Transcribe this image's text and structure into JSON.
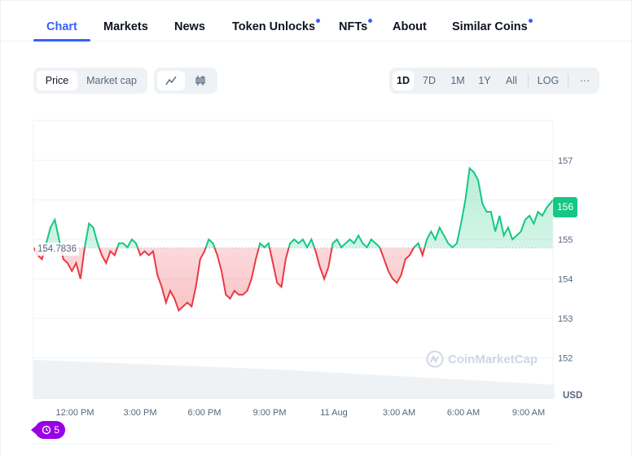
{
  "tabs": [
    {
      "label": "Chart",
      "active": true,
      "dot": false
    },
    {
      "label": "Markets",
      "active": false,
      "dot": false
    },
    {
      "label": "News",
      "active": false,
      "dot": false
    },
    {
      "label": "Token Unlocks",
      "active": false,
      "dot": true
    },
    {
      "label": "NFTs",
      "active": false,
      "dot": true
    },
    {
      "label": "About",
      "active": false,
      "dot": false
    },
    {
      "label": "Similar Coins",
      "active": false,
      "dot": true
    }
  ],
  "toolbar": {
    "metric": {
      "price": "Price",
      "market_cap": "Market cap",
      "selected": "Price"
    },
    "chart_type": {
      "line_icon": "line-chart-icon",
      "candle_icon": "candlestick-icon",
      "selected": "line"
    },
    "ranges": [
      "1D",
      "7D",
      "1M",
      "1Y",
      "All"
    ],
    "selected_range": "1D",
    "log_label": "LOG",
    "more_label": "···"
  },
  "colors": {
    "accent": "#3861fb",
    "up": "#16c784",
    "down": "#ea3943",
    "badge": "#9900e6"
  },
  "watermark": "CoinMarketCap",
  "events_badge": {
    "icon": "history-icon",
    "count": "5"
  },
  "chart_data": {
    "type": "area",
    "title": "",
    "currency_label": "USD",
    "baseline": 154.7836,
    "baseline_label": "154.7836",
    "current_price": 156,
    "current_price_label": "156",
    "ylim": [
      151.5,
      158
    ],
    "yticks": [
      157,
      156,
      155,
      154,
      153,
      152
    ],
    "xlabels": [
      "12:00 PM",
      "3:00 PM",
      "6:00 PM",
      "9:00 PM",
      "11 Aug",
      "3:00 AM",
      "6:00 AM",
      "9:00 AM"
    ],
    "x_range_hours": [
      -1.7,
      22.6
    ],
    "grid": true,
    "series": [
      {
        "name": "Price",
        "x_hours": [
          -1.7,
          -1.5,
          -1.3,
          -1.1,
          -0.9,
          -0.7,
          -0.5,
          -0.3,
          -0.1,
          0.1,
          0.3,
          0.5,
          0.7,
          0.9,
          1.1,
          1.3,
          1.5,
          1.7,
          1.9,
          2.1,
          2.3,
          2.5,
          2.7,
          2.9,
          3.1,
          3.3,
          3.5,
          3.7,
          3.9,
          4.1,
          4.3,
          4.5,
          4.7,
          4.9,
          5.1,
          5.3,
          5.5,
          5.7,
          5.9,
          6.1,
          6.3,
          6.5,
          6.7,
          6.9,
          7.1,
          7.3,
          7.5,
          7.7,
          7.9,
          8.1,
          8.3,
          8.5,
          8.7,
          8.9,
          9.1,
          9.3,
          9.5,
          9.7,
          9.9,
          10.1,
          10.3,
          10.5,
          10.7,
          10.9,
          11.1,
          11.3,
          11.5,
          11.7,
          11.9,
          12.1,
          12.3,
          12.5,
          12.7,
          12.9,
          13.1,
          13.3,
          13.5,
          13.7,
          13.9,
          14.1,
          14.3,
          14.5,
          14.7,
          14.9,
          15.1,
          15.3,
          15.5,
          15.7,
          15.9,
          16.1,
          16.3,
          16.5,
          16.7,
          16.9,
          17.1,
          17.3,
          17.5,
          17.7,
          17.9,
          18.1,
          18.3,
          18.5,
          18.7,
          18.9,
          19.1,
          19.3,
          19.5,
          19.7,
          19.9,
          20.1,
          20.3,
          20.5,
          20.7,
          20.9,
          21.1,
          21.3,
          21.5,
          21.7,
          21.9,
          22.1,
          22.3,
          22.6
        ],
        "values": [
          154.8,
          154.6,
          154.5,
          154.9,
          155.3,
          155.5,
          155.0,
          154.5,
          154.4,
          154.2,
          154.4,
          154.0,
          154.8,
          155.4,
          155.3,
          154.9,
          154.6,
          154.4,
          154.7,
          154.6,
          154.9,
          154.9,
          154.8,
          155.0,
          154.9,
          154.6,
          154.7,
          154.6,
          154.7,
          154.1,
          153.8,
          153.4,
          153.7,
          153.5,
          153.2,
          153.3,
          153.4,
          153.3,
          153.8,
          154.5,
          154.7,
          155.0,
          154.9,
          154.6,
          154.2,
          153.6,
          153.5,
          153.7,
          153.6,
          153.6,
          153.7,
          154.0,
          154.5,
          154.9,
          154.8,
          154.9,
          154.4,
          153.9,
          153.8,
          154.5,
          154.9,
          155.0,
          154.9,
          155.0,
          154.8,
          155.0,
          154.7,
          154.3,
          154.0,
          154.3,
          154.9,
          155.0,
          154.8,
          154.9,
          155.0,
          154.9,
          155.1,
          154.9,
          154.8,
          155.0,
          154.9,
          154.8,
          154.5,
          154.2,
          154.0,
          153.9,
          154.1,
          154.5,
          154.6,
          154.8,
          154.9,
          154.6,
          155.0,
          155.2,
          155.0,
          155.3,
          155.1,
          154.9,
          154.8,
          154.9,
          155.4,
          156.0,
          156.8,
          156.7,
          156.5,
          155.9,
          155.7,
          155.7,
          155.2,
          155.6,
          155.1,
          155.3,
          155.0,
          155.1,
          155.2,
          155.5,
          155.6,
          155.4,
          155.7,
          155.6,
          155.8,
          156.0
        ]
      }
    ],
    "volume_trend": "declining"
  }
}
